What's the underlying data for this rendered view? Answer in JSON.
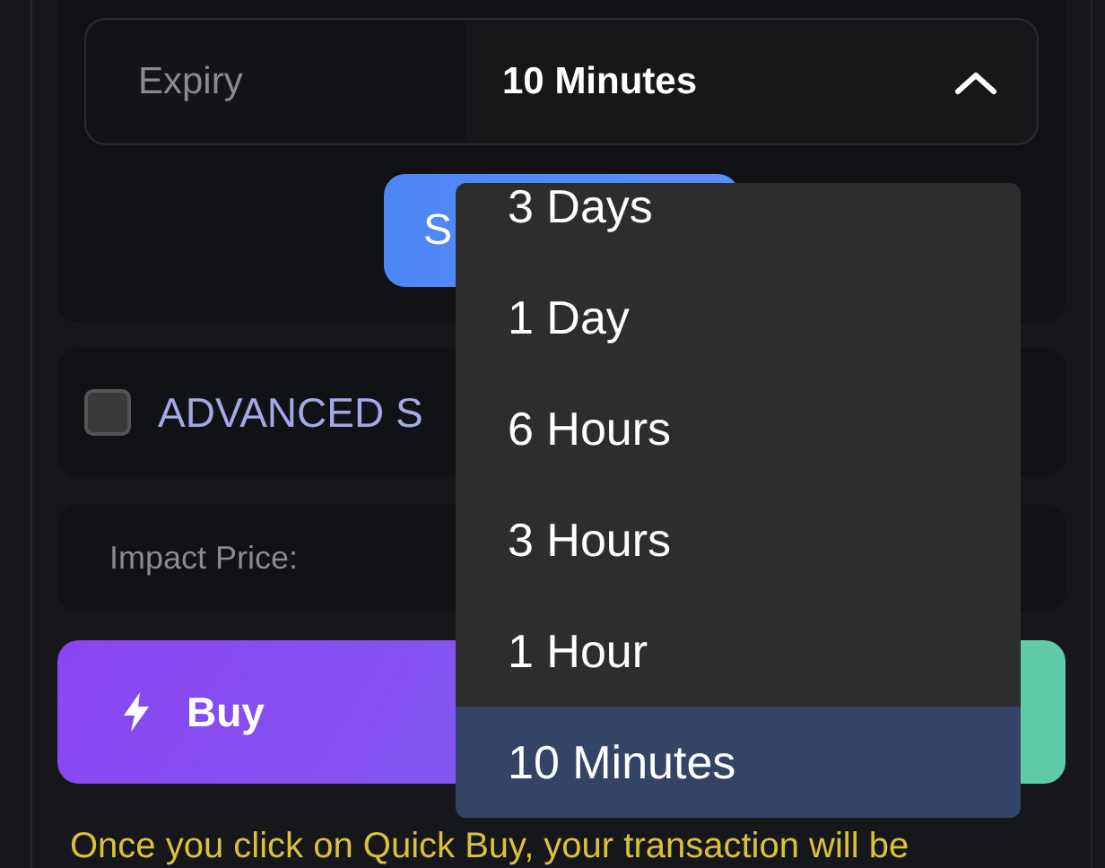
{
  "expiry": {
    "label": "Expiry",
    "value": "10 Minutes",
    "expanded": true
  },
  "submit_button": {
    "label": "S"
  },
  "menu": {
    "options": [
      {
        "label": "3 Days",
        "selected": false
      },
      {
        "label": "1 Day",
        "selected": false
      },
      {
        "label": "6 Hours",
        "selected": false
      },
      {
        "label": "3 Hours",
        "selected": false
      },
      {
        "label": "1 Hour",
        "selected": false
      },
      {
        "label": "10 Minutes",
        "selected": true
      }
    ]
  },
  "advanced": {
    "label": "ADVANCED S",
    "checked": false
  },
  "impact_price": {
    "label": "Impact Price:"
  },
  "buy_button": {
    "label": "Buy"
  },
  "notice": "Once you click on Quick Buy, your transaction will be"
}
